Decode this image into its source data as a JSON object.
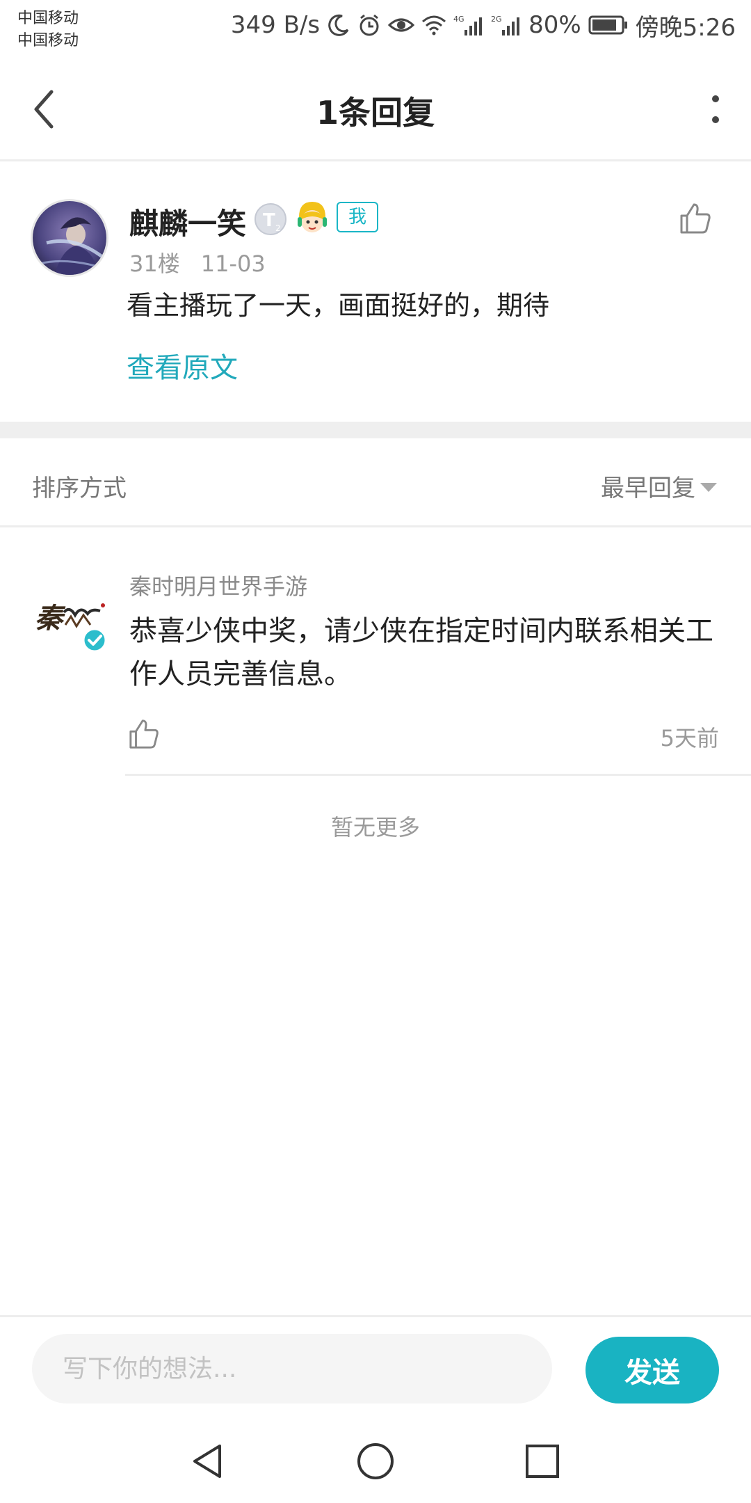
{
  "status_bar": {
    "carrier_1": "中国移动",
    "carrier_2": "中国移动",
    "net_speed": "349 B/s",
    "battery": "80%",
    "time": "傍晚5:26",
    "icons": [
      "moon-icon",
      "alarm-icon",
      "eye-icon",
      "wifi-icon",
      "signal-4g-icon",
      "signal-2g-icon",
      "battery-icon"
    ]
  },
  "header": {
    "title": "1条回复"
  },
  "main_comment": {
    "user_name": "麒麟一笑",
    "me_badge": "我",
    "floor": "31楼",
    "date": "11-03",
    "text": "看主播玩了一天，画面挺好的，期待",
    "view_original": "查看原文"
  },
  "sort": {
    "label": "排序方式",
    "value": "最早回复"
  },
  "replies": [
    {
      "author": "秦时明月世界手游",
      "text": "恭喜少侠中奖，请少侠在指定时间内联系相关工作人员完善信息。",
      "time": "5天前"
    }
  ],
  "no_more": "暂无更多",
  "composer": {
    "placeholder": "写下你的想法...",
    "send_label": "发送"
  },
  "colors": {
    "accent": "#19b3c2",
    "link": "#21a9bb",
    "divider": "#efefef"
  }
}
